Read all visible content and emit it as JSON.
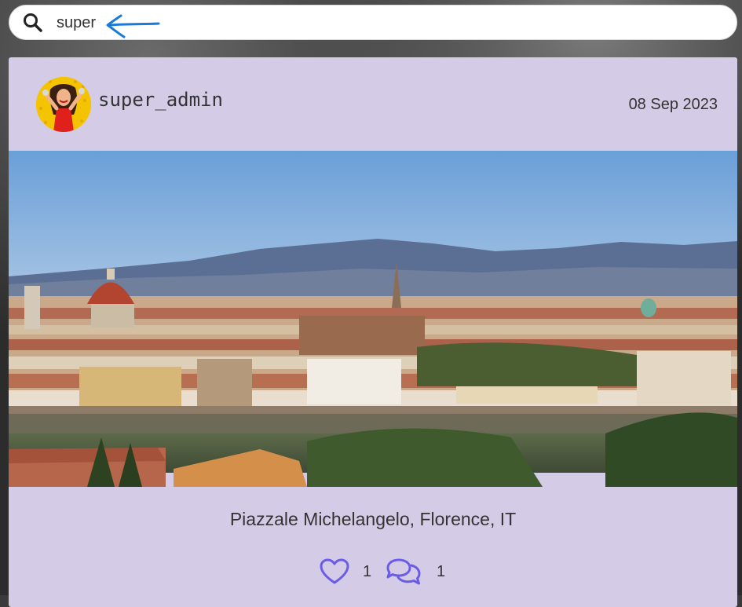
{
  "search": {
    "value": "super",
    "icon": "search-icon"
  },
  "post": {
    "username": "super_admin",
    "date": "08 Sep 2023",
    "avatar_icon": "avatar",
    "photo": "florence-panorama",
    "caption": "Piazzale Michelangelo, Florence, IT",
    "likes": "1",
    "comments": "1",
    "like_icon": "heart-icon",
    "comment_icon": "comments-icon"
  },
  "colors": {
    "card_bg": "#d4cce6",
    "accent_icon": "#6a5ce8",
    "annotation_arrow": "#1a7ad8"
  }
}
